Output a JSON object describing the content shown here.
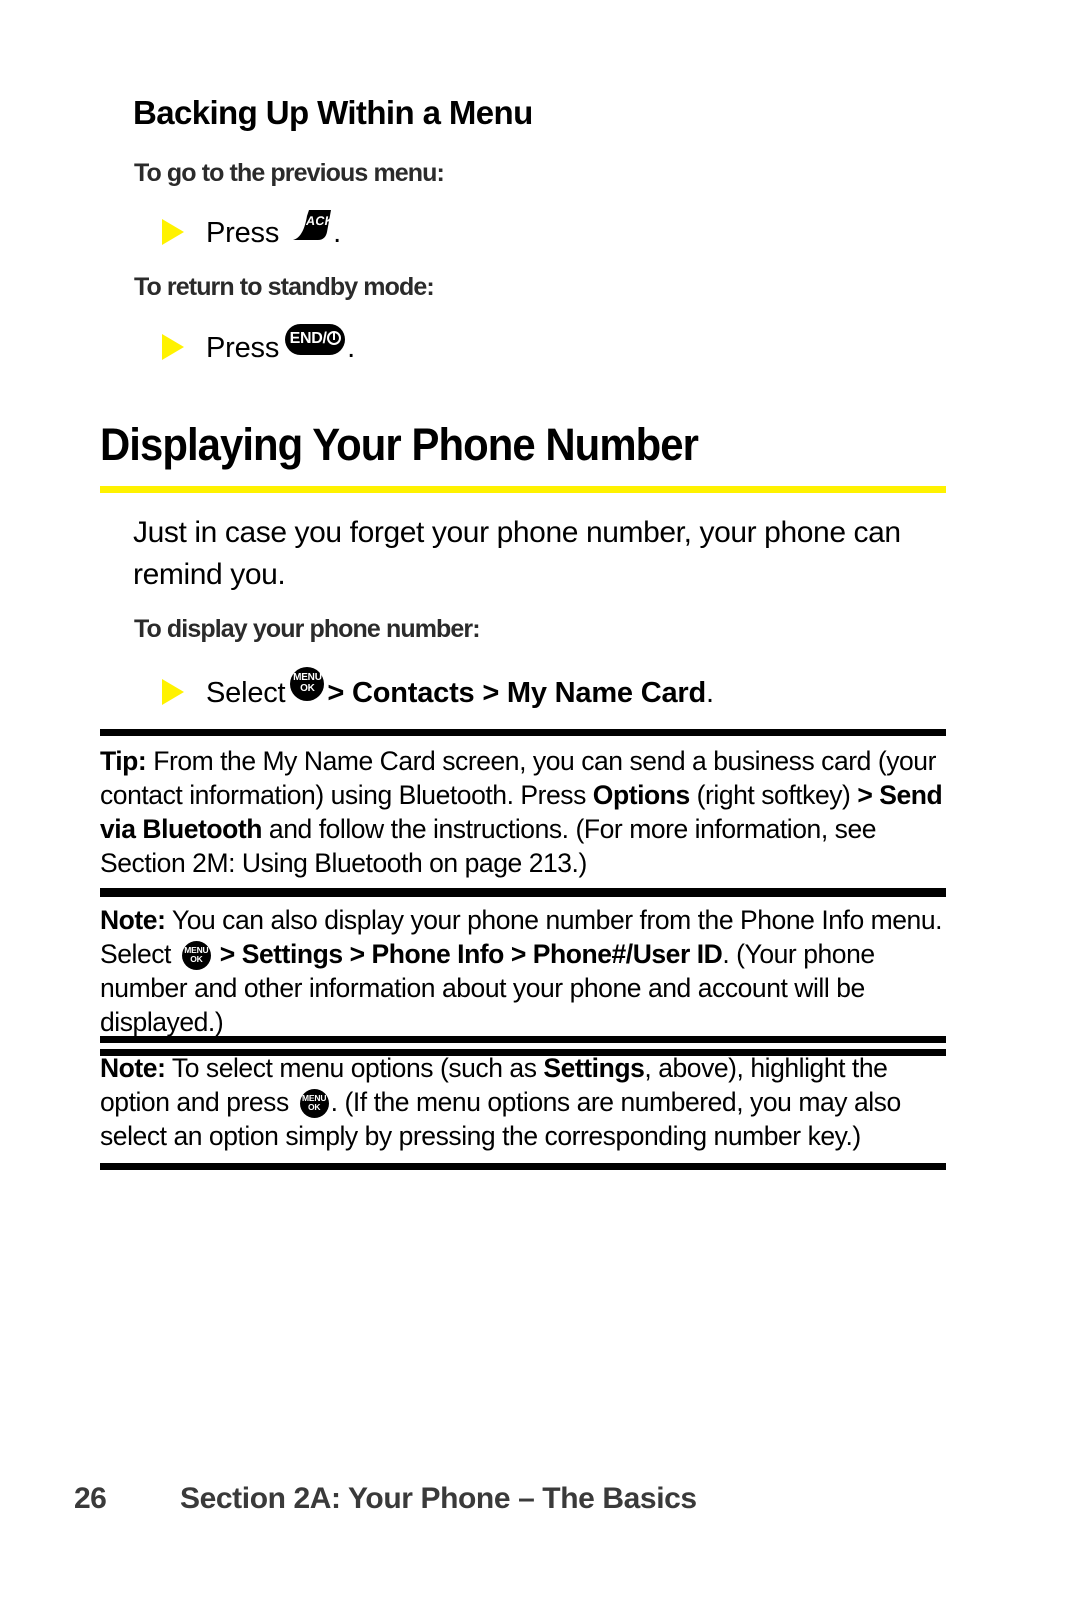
{
  "section": {
    "heading": "Backing Up Within a Menu",
    "sub_headings": {
      "previous_menu": "To go to the previous menu:",
      "standby_mode": "To return to standby mode:",
      "display_number": "To display your phone number:"
    },
    "steps": {
      "press_back_prefix": "Press",
      "press_back_suffix": ".",
      "press_end_prefix": "Press",
      "press_end_suffix": ".",
      "select_prefix": "Select",
      "select_path": "> Contacts > My Name Card",
      "select_suffix": "."
    }
  },
  "title": "Displaying Your Phone Number",
  "intro_paragraph": "Just in case you forget your phone number, your phone can remind you.",
  "keys": {
    "back": {
      "name": "back-key",
      "label": "BACK"
    },
    "end": {
      "name": "end-key",
      "label": "END/"
    },
    "menu_ok": {
      "name": "menu-ok-key",
      "line1": "MENU",
      "line2": "OK"
    }
  },
  "callouts": [
    {
      "lead": "Tip:",
      "segments": [
        {
          "text": " From the My Name Card screen, you can send a business card (your contact information) using Bluetooth. Press ",
          "bold": false
        },
        {
          "text": "Options",
          "bold": true
        },
        {
          "text": " (right softkey) ",
          "bold": false
        },
        {
          "text": ">",
          "bold": true
        },
        {
          "text": " ",
          "bold": false
        },
        {
          "text": "Send via Bluetooth",
          "bold": true
        },
        {
          "text": " and follow the instructions. (For more information, see Section 2M: Using Bluetooth on page 213.)",
          "bold": false
        }
      ]
    },
    {
      "lead": "Note:",
      "segments": [
        {
          "text": " You can also display your phone number from the Phone Info menu. Select ",
          "bold": false
        },
        {
          "key": "menu_ok"
        },
        {
          "text": " ",
          "bold": false
        },
        {
          "text": "> Settings > Phone Info > Phone#/User ID",
          "bold": true
        },
        {
          "text": ". (Your phone number and other information about your phone and account will be displayed.)",
          "bold": false
        }
      ]
    },
    {
      "lead": "Note:",
      "segments": [
        {
          "text": " To select menu options (such as ",
          "bold": false
        },
        {
          "text": "Settings",
          "bold": true
        },
        {
          "text": ", above), highlight the option and press ",
          "bold": false
        },
        {
          "key": "menu_ok"
        },
        {
          "text": ". (If the menu options are numbered, you may also select an option simply by pressing the corresponding number key.)",
          "bold": false
        }
      ]
    }
  ],
  "footer": {
    "page_number": "26",
    "section_title": "Section 2A: Your Phone – The Basics"
  },
  "colors": {
    "accent_yellow": "#fff200",
    "rule_black": "#000000",
    "text_gray": "#3a3a3a"
  }
}
